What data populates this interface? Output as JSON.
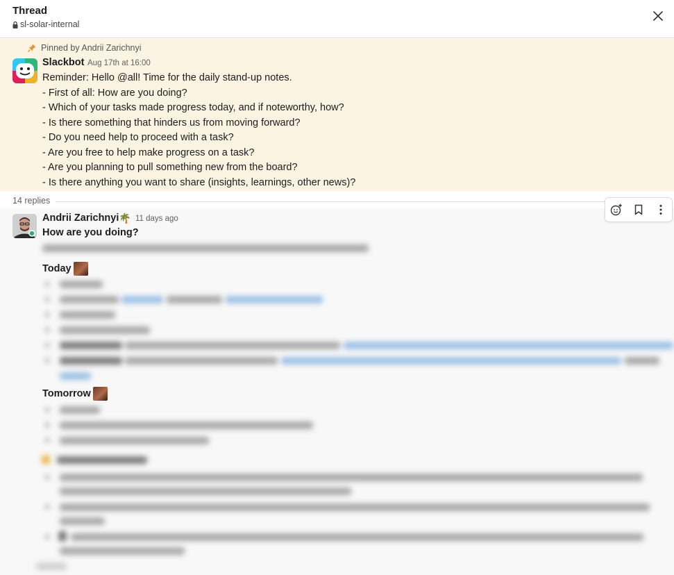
{
  "header": {
    "title": "Thread",
    "channel": "sl-solar-internal"
  },
  "pinned": {
    "label": "Pinned by Andrii Zarichnyi",
    "author": "Slackbot",
    "timestamp": "Aug 17th at 16:00",
    "lines": [
      "Reminder: Hello @all! Time for the daily stand-up notes.",
      "- First of all: How are you doing?",
      "- Which of your tasks made progress today, and if noteworthy, how?",
      "- Is there something that hinders us from moving forward?",
      "- Do you need help to proceed with a task?",
      "- Are you free to help make progress on a task?",
      "- Are you planning to pull something new from the board?",
      "- Is there anything you want to share (insights, learnings, other news)?"
    ]
  },
  "replies_count": "14 replies",
  "reply": {
    "author": "Andrii Zarichnyi",
    "status_emoji": "🌴",
    "timestamp": "11 days ago",
    "heading": "How are you doing?",
    "today_label": "Today",
    "tomorrow_label": "Tomorrow"
  },
  "icons": {
    "lock": "lock-icon",
    "close": "close-icon",
    "pin": "pin-icon",
    "add_reaction": "add-reaction-icon",
    "bookmark": "bookmark-icon",
    "more": "more-vertical-icon"
  },
  "colors": {
    "pinned_bg": "#fcf4e3",
    "pin_accent": "#e8912d",
    "reply_bg": "#f8f8f8"
  }
}
